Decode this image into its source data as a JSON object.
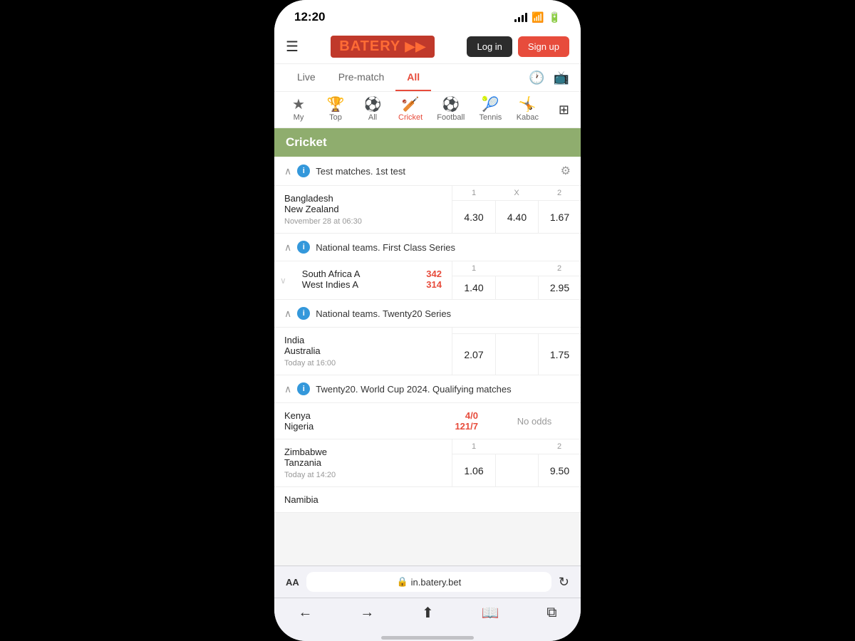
{
  "status": {
    "time": "12:20",
    "signal": [
      3,
      6,
      9,
      12,
      14
    ],
    "wifi": "▲",
    "battery": "🔋"
  },
  "header": {
    "logo": "BATERY",
    "login_label": "Log in",
    "signup_label": "Sign up"
  },
  "nav": {
    "tabs": [
      {
        "label": "Live",
        "active": false
      },
      {
        "label": "Pre-match",
        "active": false
      },
      {
        "label": "All",
        "active": true
      }
    ]
  },
  "sports": [
    {
      "label": "My",
      "icon": "★",
      "active": false
    },
    {
      "label": "Top",
      "icon": "🏆",
      "active": false
    },
    {
      "label": "All",
      "icon": "⚽",
      "active": false
    },
    {
      "label": "Cricket",
      "icon": "🏏",
      "active": true
    },
    {
      "label": "Football",
      "icon": "⚽",
      "active": false
    },
    {
      "label": "Tennis",
      "icon": "🎾",
      "active": false
    },
    {
      "label": "Kabac",
      "icon": "🤸",
      "active": false
    }
  ],
  "category": {
    "title": "Cricket"
  },
  "sections": [
    {
      "id": "test-matches",
      "title": "Test matches. 1st test",
      "collapsed": false,
      "matches": [
        {
          "team1": "Bangladesh",
          "team2": "New Zealand",
          "score1": "",
          "score2": "",
          "time": "November 28 at 06:30",
          "odds_headers": [
            "1",
            "X",
            "2"
          ],
          "odds": [
            "4.30",
            "4.40",
            "1.67"
          ],
          "no_odds": false
        }
      ]
    },
    {
      "id": "national-first-class",
      "title": "National teams. First Class Series",
      "collapsed": false,
      "matches": [
        {
          "team1": "South Africa A",
          "team2": "West Indies A",
          "score1": "342",
          "score2": "314",
          "time": "",
          "odds_headers": [
            "1",
            "",
            "2"
          ],
          "odds": [
            "1.40",
            "",
            "2.95"
          ],
          "no_odds": false,
          "live": true
        }
      ]
    },
    {
      "id": "national-t20",
      "title": "National teams. Twenty20 Series",
      "collapsed": false,
      "matches": [
        {
          "team1": "India",
          "team2": "Australia",
          "score1": "",
          "score2": "",
          "time": "Today at 16:00",
          "odds_headers": [
            "",
            "",
            ""
          ],
          "odds": [
            "2.07",
            "",
            "1.75"
          ],
          "no_odds": false
        }
      ]
    },
    {
      "id": "t20-worldcup",
      "title": "Twenty20. World Cup 2024. Qualifying matches",
      "collapsed": false,
      "matches": [
        {
          "team1": "Kenya",
          "team2": "Nigeria",
          "score1": "4/0",
          "score2": "121/7",
          "time": "",
          "odds": [],
          "no_odds": true,
          "no_odds_label": "No odds",
          "live": true
        },
        {
          "team1": "Zimbabwe",
          "team2": "Tanzania",
          "score1": "",
          "score2": "",
          "time": "Today at 14:20",
          "odds_headers": [
            "1",
            "",
            "2"
          ],
          "odds": [
            "1.06",
            "",
            "9.50"
          ],
          "no_odds": false
        },
        {
          "team1": "Namibia",
          "team2": "",
          "score1": "",
          "score2": "",
          "time": "",
          "odds": [],
          "no_odds": false,
          "partial": true
        }
      ]
    }
  ],
  "browser": {
    "aa_label": "AA",
    "url": "in.batery.bet",
    "lock_icon": "🔒"
  },
  "bottom_nav": {
    "items": [
      "←",
      "→",
      "⬆",
      "📖",
      "⧉"
    ]
  }
}
